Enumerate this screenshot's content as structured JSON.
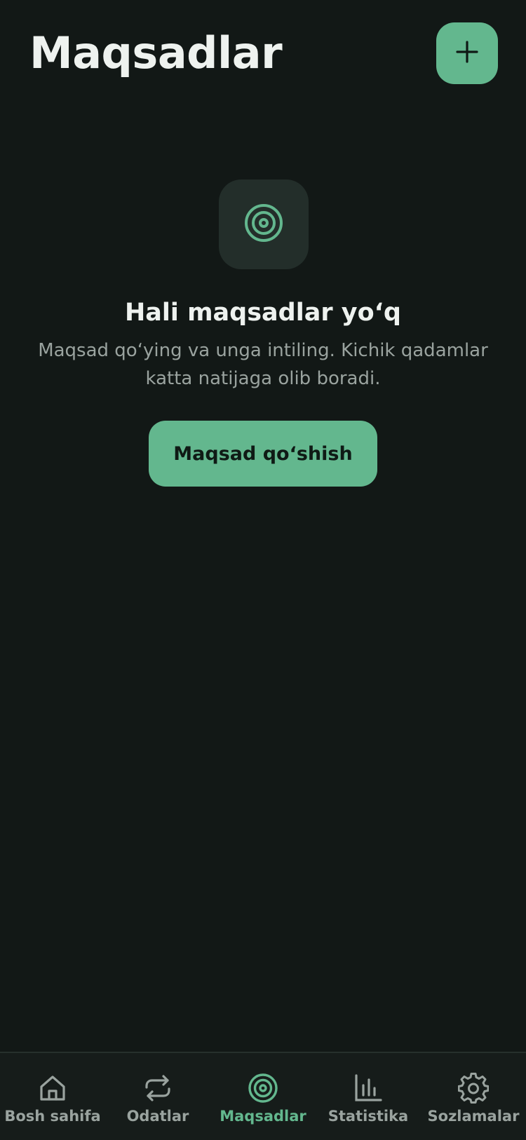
{
  "header": {
    "title": "Maqsadlar",
    "add_icon": "plus-icon"
  },
  "empty_state": {
    "icon": "target-icon",
    "title": "Hali maqsadlar yo‘q",
    "description": "Maqsad qo‘ying va unga intiling. Kichik qadamlar katta natijaga olib boradi.",
    "button_label": "Maqsad qo‘shish"
  },
  "bottom_nav": {
    "active_index": 2,
    "items": [
      {
        "label": "Bosh sahifa",
        "icon": "home-icon"
      },
      {
        "label": "Odatlar",
        "icon": "repeat-icon"
      },
      {
        "label": "Maqsadlar",
        "icon": "target-icon"
      },
      {
        "label": "Statistika",
        "icon": "bar-chart-icon"
      },
      {
        "label": "Sozlamalar",
        "icon": "gear-icon"
      }
    ]
  },
  "colors": {
    "background": "#121816",
    "accent": "#63b78e",
    "muted_text": "#9aa39f",
    "icon_box": "#232e2a"
  }
}
